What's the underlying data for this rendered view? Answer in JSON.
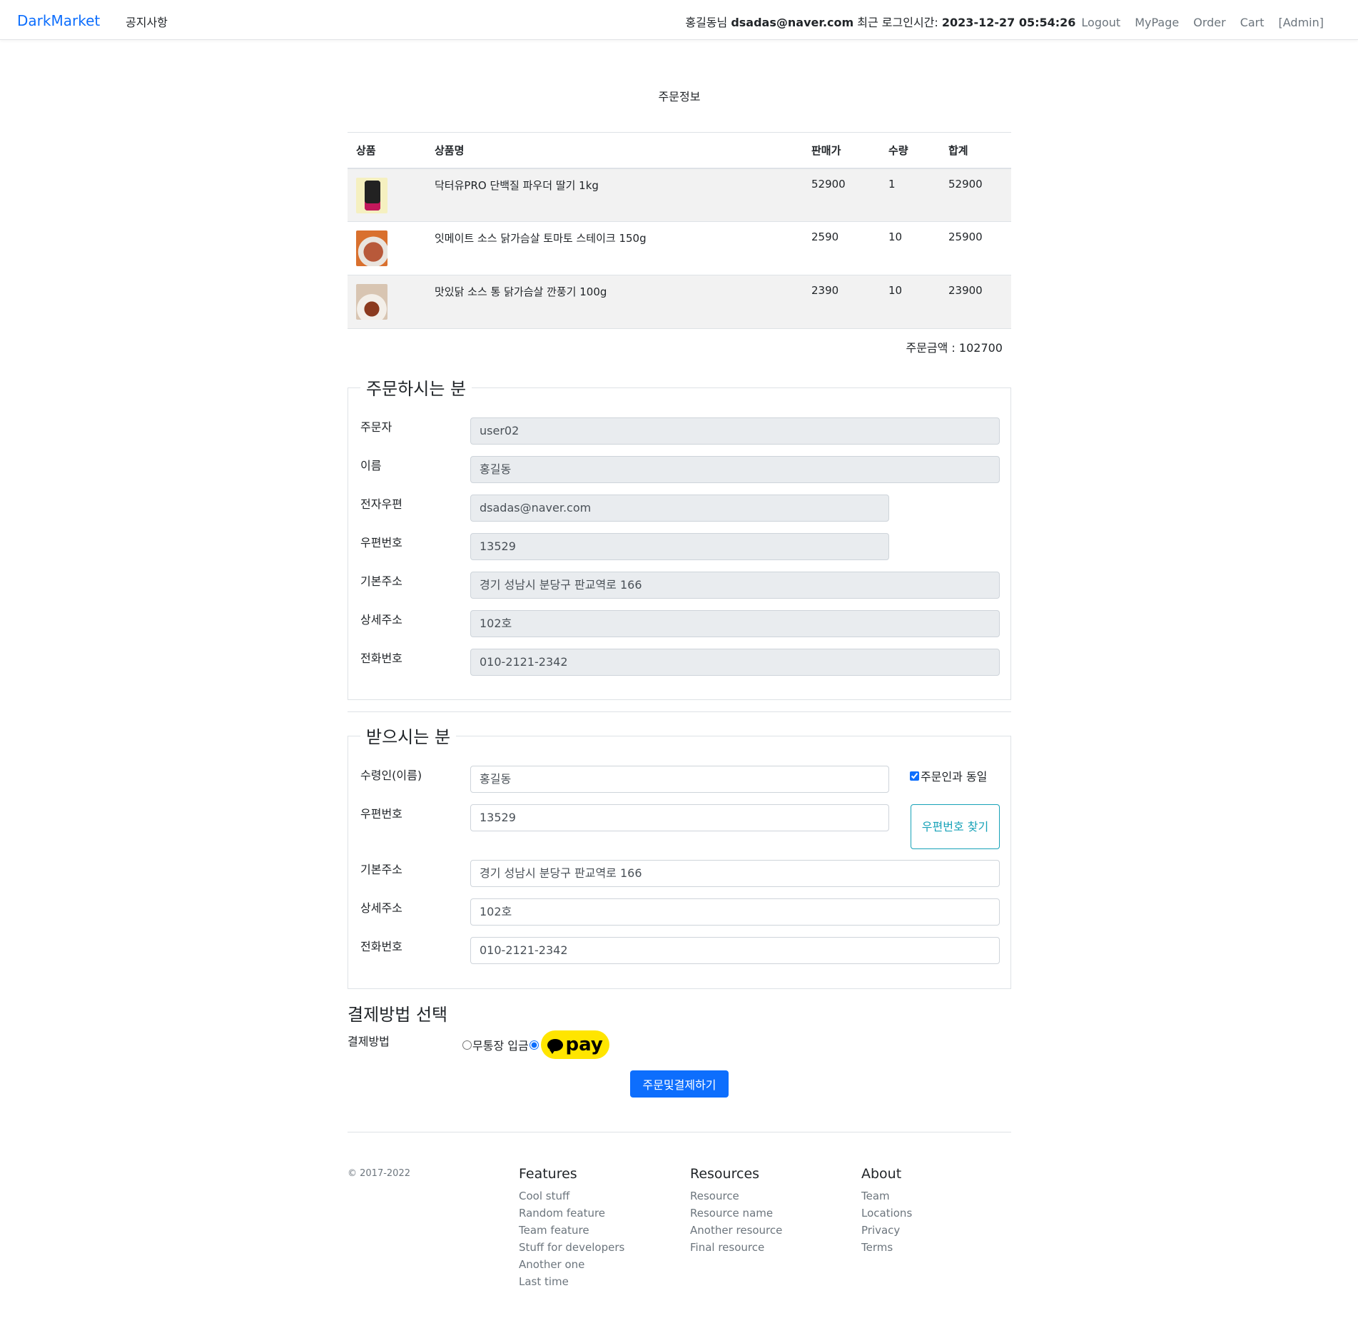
{
  "navbar": {
    "brand": "DarkMarket",
    "notice": "공지사항",
    "user_greeting": "홍길동님",
    "user_email": "dsadas@naver.com",
    "last_login_label": "최근 로그인시간:",
    "last_login_time": "2023-12-27 05:54:26",
    "links": [
      "Logout",
      "MyPage",
      "Order",
      "Cart",
      "[Admin]"
    ]
  },
  "page_title": "주문정보",
  "items_table": {
    "headers": [
      "상품",
      "상품명",
      "판매가",
      "수량",
      "합계"
    ],
    "rows": [
      {
        "name": "닥터유PRO 단백질 파우더 딸기 1kg",
        "price": "52900",
        "qty": "1",
        "total": "52900"
      },
      {
        "name": "잇메이트 소스 닭가슴살 토마토 스테이크 150g",
        "price": "2590",
        "qty": "10",
        "total": "25900"
      },
      {
        "name": "맛있닭 소스 통 닭가슴살 깐풍기 100g",
        "price": "2390",
        "qty": "10",
        "total": "23900"
      }
    ]
  },
  "order_total": "주문금액 : 102700",
  "orderer": {
    "legend": "주문하시는 분",
    "fields": [
      {
        "label": "주문자",
        "value": "user02"
      },
      {
        "label": "이름",
        "value": "홍길동"
      },
      {
        "label": "전자우편",
        "value": "dsadas@naver.com"
      },
      {
        "label": "우편번호",
        "value": "13529"
      },
      {
        "label": "기본주소",
        "value": "경기 성남시 분당구 판교역로 166"
      },
      {
        "label": "상세주소",
        "value": "102호"
      },
      {
        "label": "전화번호",
        "value": "010-2121-2342"
      }
    ]
  },
  "receiver": {
    "legend": "받으시는 분",
    "same_as_orderer": "주문인과 동일",
    "zip_button": "우편번호 찾기",
    "fields": [
      {
        "label": "수령인(이름)",
        "value": "홍길동"
      },
      {
        "label": "우편번호",
        "value": "13529"
      },
      {
        "label": "기본주소",
        "value": "경기 성남시 분당구 판교역로 166"
      },
      {
        "label": "상세주소",
        "value": "102호"
      },
      {
        "label": "전화번호",
        "value": "010-2121-2342"
      }
    ]
  },
  "payment": {
    "title": "결제방법 선택",
    "label": "결제방법",
    "option_bank": "무통장 입금",
    "option_kakao": "pay",
    "selected": "kakaopay"
  },
  "submit_label": "주문및결제하기",
  "footer": {
    "copyright": "© 2017-2022",
    "columns": [
      {
        "title": "Features",
        "links": [
          "Cool stuff",
          "Random feature",
          "Team feature",
          "Stuff for developers",
          "Another one",
          "Last time"
        ]
      },
      {
        "title": "Resources",
        "links": [
          "Resource",
          "Resource name",
          "Another resource",
          "Final resource"
        ]
      },
      {
        "title": "About",
        "links": [
          "Team",
          "Locations",
          "Privacy",
          "Terms"
        ]
      }
    ]
  },
  "colors": {
    "primary": "#0d6efd",
    "info": "#17a2b8",
    "kakao": "#ffe500"
  }
}
